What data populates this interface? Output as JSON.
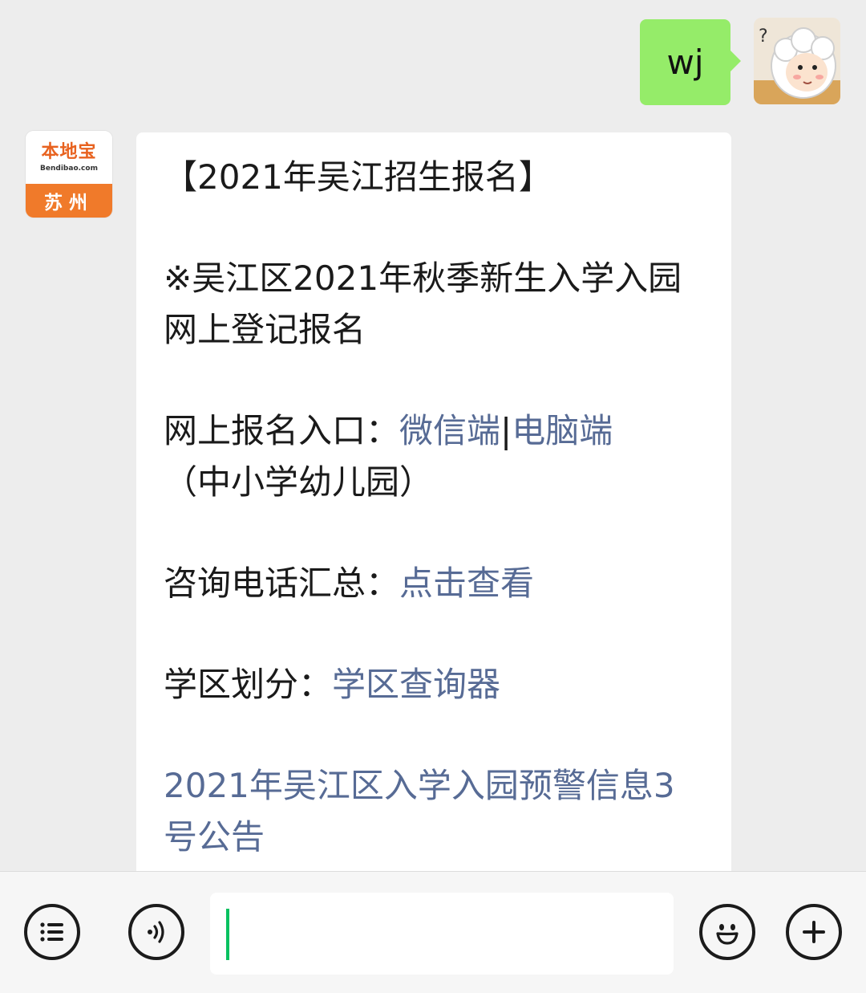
{
  "chat": {
    "outgoing": {
      "text": "wj"
    },
    "incoming": {
      "sender_logo": {
        "title": "本地宝",
        "url": "Bendibao.com",
        "city": "苏州"
      },
      "heading": "【2021年吴江招生报名】",
      "notice": "※吴江区2021年秋季新生入学入园网上登记报名",
      "entry_label": "网上报名入口：",
      "entry_link_wechat": "微信端",
      "entry_separator": "|",
      "entry_link_pc": "电脑端",
      "entry_scope": "（中小学幼儿园）",
      "phone_label": "咨询电话汇总：",
      "phone_link": "点击查看",
      "district_label": "学区划分：",
      "district_link": "学区查询器",
      "warning_link": "2021年吴江区入学入园预警信息3号公告"
    }
  },
  "input_bar": {
    "menu_icon": "list-menu-icon",
    "voice_icon": "voice-icon",
    "emoji_icon": "smiley-icon",
    "more_icon": "plus-icon",
    "input_value": ""
  },
  "colors": {
    "background": "#ededed",
    "outgoing_bubble": "#95ec69",
    "incoming_bubble": "#ffffff",
    "link": "#576b95",
    "logo_orange": "#f07a2a",
    "caret": "#07c160"
  }
}
